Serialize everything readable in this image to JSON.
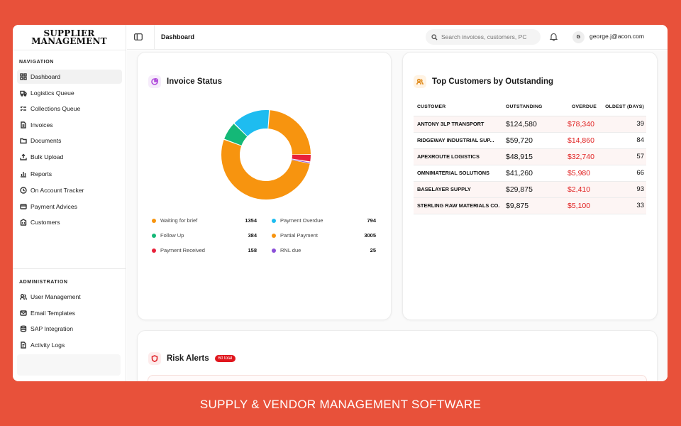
{
  "app": {
    "logo_line1": "SUPPLIER",
    "logo_line2": "MANAGEMENT"
  },
  "sidebar": {
    "nav_heading": "NAVIGATION",
    "nav_items": [
      {
        "label": "Dashboard",
        "icon": "dashboard-icon",
        "active": true
      },
      {
        "label": "Logistics Queue",
        "icon": "truck-icon"
      },
      {
        "label": "Collections Queue",
        "icon": "list-check-icon"
      },
      {
        "label": "Invoices",
        "icon": "file-icon"
      },
      {
        "label": "Documents",
        "icon": "folder-icon"
      },
      {
        "label": "Bulk Upload",
        "icon": "upload-icon"
      },
      {
        "label": "Reports",
        "icon": "bar-chart-icon"
      },
      {
        "label": "On Account Tracker",
        "icon": "clock-icon"
      },
      {
        "label": "Payment Advices",
        "icon": "credit-card-icon"
      },
      {
        "label": "Customers",
        "icon": "building-icon"
      }
    ],
    "admin_heading": "ADMINISTRATION",
    "admin_items": [
      {
        "label": "User Management",
        "icon": "users-icon"
      },
      {
        "label": "Email Templates",
        "icon": "mail-icon"
      },
      {
        "label": "SAP Integration",
        "icon": "database-icon"
      },
      {
        "label": "Activity Logs",
        "icon": "log-icon"
      }
    ]
  },
  "header": {
    "title": "Dashboard",
    "search_placeholder": "Search invoices, customers, PC",
    "avatar_initial": "G",
    "user_email": "george.j@acon.com"
  },
  "invoice_status": {
    "title": "Invoice Status",
    "legend": [
      {
        "label": "Waiting for brief",
        "value": "1354",
        "color": "#f7940f"
      },
      {
        "label": "Payment Overdue",
        "value": "794",
        "color": "#1ebcf0"
      },
      {
        "label": "Follow Up",
        "value": "384",
        "color": "#14b877"
      },
      {
        "label": "Partial Payment",
        "value": "3005",
        "color": "#f7940f"
      },
      {
        "label": "Payment Received",
        "value": "158",
        "color": "#e8213a"
      },
      {
        "label": "RNL due",
        "value": "25",
        "color": "#8b4fd8"
      }
    ]
  },
  "top_customers": {
    "title": "Top Customers by Outstanding",
    "columns": [
      "CUSTOMER",
      "OUTSTANDING",
      "OVERDUE",
      "OLDEST (DAYS)"
    ],
    "rows": [
      {
        "customer": "ANTONY 3LP TRANSPORT",
        "outstanding": "$124,580",
        "overdue": "$78,340",
        "oldest": "39"
      },
      {
        "customer": "RIDGEWAY INDUSTRIAL SUP...",
        "outstanding": "$59,720",
        "overdue": "$14,860",
        "oldest": "84"
      },
      {
        "customer": "APEXROUTE LOGISTICS",
        "outstanding": "$48,915",
        "overdue": "$32,740",
        "oldest": "57"
      },
      {
        "customer": "OMNIMATERIAL SOLUTIONS",
        "outstanding": "$41,260",
        "overdue": "$5,980",
        "oldest": "66"
      },
      {
        "customer": "BASELAYER SUPPLY",
        "outstanding": "$29,875",
        "overdue": "$2,410",
        "oldest": "93"
      },
      {
        "customer": "STERLING RAW MATERIALS CO.",
        "outstanding": "$9,875",
        "overdue": "$5,100",
        "oldest": "33"
      }
    ]
  },
  "risk_alerts": {
    "title": "Risk Alerts",
    "badge": "60 total"
  },
  "caption": "SUPPLY & VENDOR MANAGEMENT SOFTWARE"
}
